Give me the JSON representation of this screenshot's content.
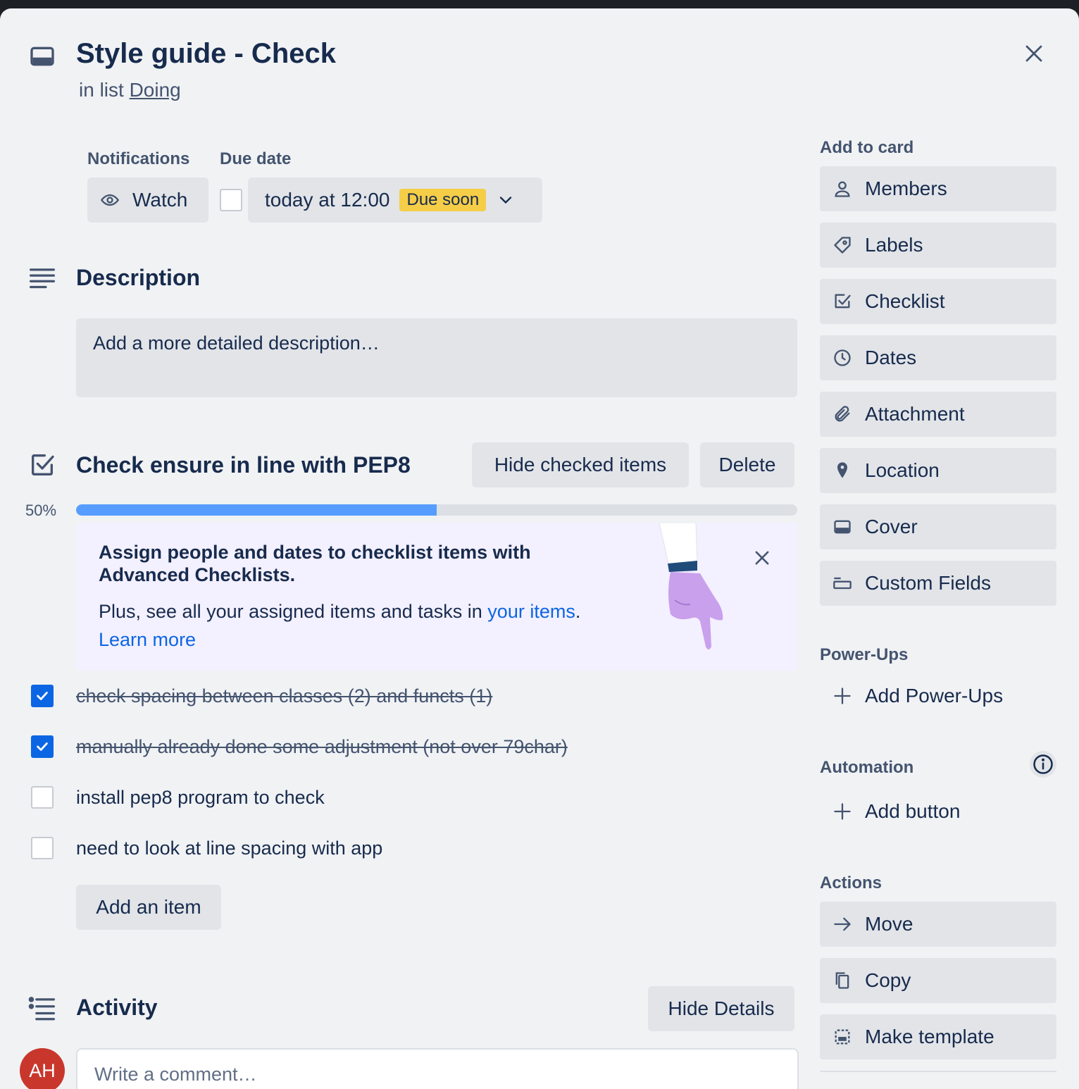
{
  "card": {
    "title": "Style guide - Check",
    "list_prefix": "in list",
    "list_name": "Doing"
  },
  "notifications": {
    "label": "Notifications",
    "watch_label": "Watch"
  },
  "due_date": {
    "label": "Due date",
    "value": "today at 12:00",
    "badge": "Due soon",
    "badge_color": "#f5cd47",
    "completed": false
  },
  "description": {
    "title": "Description",
    "placeholder": "Add a more detailed description…"
  },
  "checklist": {
    "title": "Check ensure in line with PEP8",
    "hide_checked_label": "Hide checked items",
    "delete_label": "Delete",
    "percent_text": "50%",
    "progress": 0.5,
    "progress_color": "#579dff",
    "promo": {
      "title": "Assign people and dates to checklist items with Advanced Checklists.",
      "body_prefix": "Plus, see all your assigned items and tasks in",
      "your_items_link": "your items",
      "body_suffix": ".",
      "learn_more": "Learn more"
    },
    "items": [
      {
        "text": "check spacing between classes (2) and functs (1)",
        "checked": true
      },
      {
        "text": "manually already done some adjustment (not over 79char)",
        "checked": true
      },
      {
        "text": "install pep8 program to check",
        "checked": false
      },
      {
        "text": "need to look at line spacing with app",
        "checked": false
      }
    ],
    "add_item_label": "Add an item"
  },
  "activity": {
    "title": "Activity",
    "hide_details_label": "Hide Details",
    "avatar_initials": "AH",
    "avatar_color": "#c9372c",
    "comment_placeholder": "Write a comment…"
  },
  "sidebar": {
    "add_to_card_title": "Add to card",
    "add_to_card": [
      {
        "label": "Members",
        "icon": "person-icon"
      },
      {
        "label": "Labels",
        "icon": "tag-icon"
      },
      {
        "label": "Checklist",
        "icon": "checkbox-icon"
      },
      {
        "label": "Dates",
        "icon": "clock-icon"
      },
      {
        "label": "Attachment",
        "icon": "paperclip-icon"
      },
      {
        "label": "Location",
        "icon": "map-pin-icon"
      },
      {
        "label": "Cover",
        "icon": "cover-icon"
      },
      {
        "label": "Custom Fields",
        "icon": "custom-fields-icon"
      }
    ],
    "powerups_title": "Power-Ups",
    "add_powerups_label": "Add Power-Ups",
    "automation_title": "Automation",
    "add_button_label": "Add button",
    "actions_title": "Actions",
    "actions": [
      {
        "label": "Move",
        "icon": "arrow-right-icon"
      },
      {
        "label": "Copy",
        "icon": "copy-icon"
      },
      {
        "label": "Make template",
        "icon": "template-icon"
      }
    ]
  }
}
